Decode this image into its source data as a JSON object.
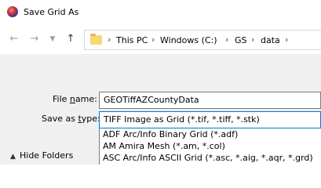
{
  "window": {
    "title": "Save Grid As"
  },
  "nav": {
    "back_icon": "arrow-left-icon",
    "forward_icon": "arrow-right-icon",
    "recent_icon": "chevron-down-icon",
    "up_icon": "arrow-up-icon"
  },
  "breadcrumb": {
    "items": [
      "This PC",
      "Windows (C:)",
      "GS",
      "data"
    ],
    "separator": "›"
  },
  "form": {
    "filename_label_pre": "File ",
    "filename_label_ul": "n",
    "filename_label_post": "ame:",
    "filename_value": "GEOTiffAZCountyData",
    "savetype_label_pre": "Save as ",
    "savetype_label_ul": "t",
    "savetype_label_post": "ype:",
    "savetype_value": "TIFF Image as Grid (*.tif, *.tiff, *.stk)"
  },
  "dropdown": {
    "options": [
      "ADF Arc/Info Binary Grid (*.adf)",
      "AM  Amira Mesh (*.am, *.col)",
      "ASC Arc/Info ASCII Grid (*.asc, *.aig, *.aqr, *.grd)"
    ]
  },
  "footer": {
    "hide_folders_label": "Hide Folders"
  }
}
